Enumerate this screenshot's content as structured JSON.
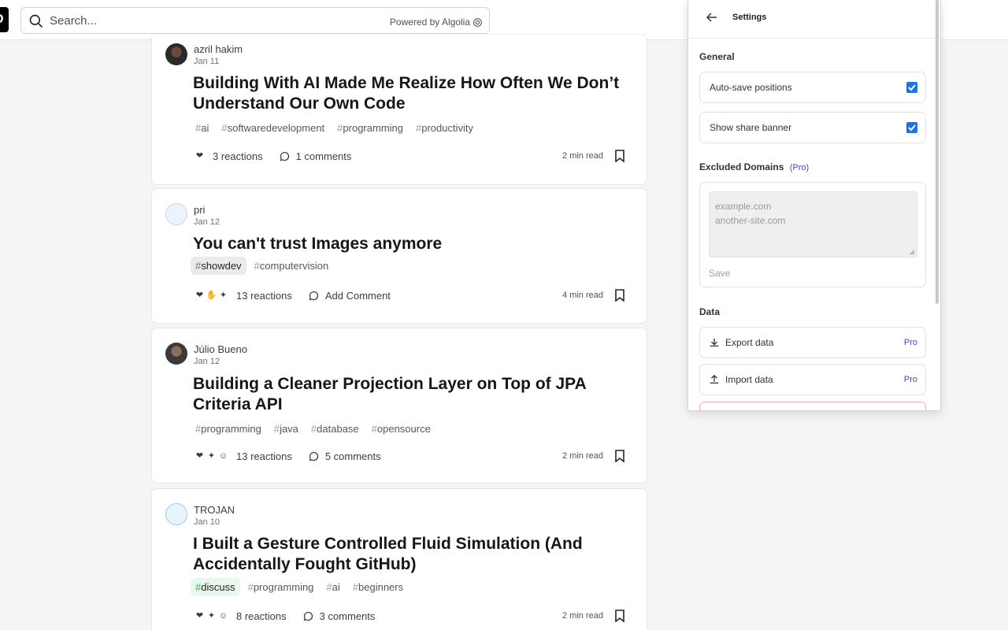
{
  "search": {
    "placeholder": "Search...",
    "powered": "Powered by Algolia"
  },
  "articles": [
    {
      "author": "azril hakim",
      "date": "Jan 11",
      "title": "Building With AI Made Me Realize How Often We Don’t Understand Our Own Code",
      "tags": [
        "ai",
        "softwaredevelopment",
        "programming",
        "productivity"
      ],
      "reactions": "3 reactions",
      "comments": "1 comments",
      "read_time": "2 min read"
    },
    {
      "author": "pri",
      "date": "Jan 12",
      "title": "You can't trust Images anymore",
      "tags": [
        "showdev",
        "computervision"
      ],
      "reactions": "13 reactions",
      "comments": "Add Comment",
      "read_time": "4 min read"
    },
    {
      "author": "Júlio Bueno",
      "date": "Jan 12",
      "title": "Building a Cleaner Projection Layer on Top of JPA Criteria API",
      "tags": [
        "programming",
        "java",
        "database",
        "opensource"
      ],
      "reactions": "13 reactions",
      "comments": "5 comments",
      "read_time": "2 min read"
    },
    {
      "author": "TROJAN",
      "date": "Jan 10",
      "title": "I Built a Gesture Controlled Fluid Simulation (And Accidentally Fought GitHub)",
      "tags": [
        "discuss",
        "programming",
        "ai",
        "beginners"
      ],
      "reactions": "8 reactions",
      "comments": "3 comments",
      "read_time": "2 min read"
    }
  ],
  "settings": {
    "title": "Settings",
    "general_heading": "General",
    "auto_save": {
      "label": "Auto-save positions",
      "checked": true
    },
    "share_banner": {
      "label": "Show share banner",
      "checked": true
    },
    "excluded_heading": "Excluded Domains",
    "excluded_pro": "(Pro)",
    "excluded_placeholder_line1": "example.com",
    "excluded_placeholder_line2": "another-site.com",
    "save_label": "Save",
    "data_heading": "Data",
    "export_label": "Export data",
    "import_label": "Import data",
    "pro_label": "Pro"
  },
  "colors": {
    "accent": "#1a73e8",
    "pro": "#4f46b8",
    "danger_border": "#f4a9b1"
  }
}
